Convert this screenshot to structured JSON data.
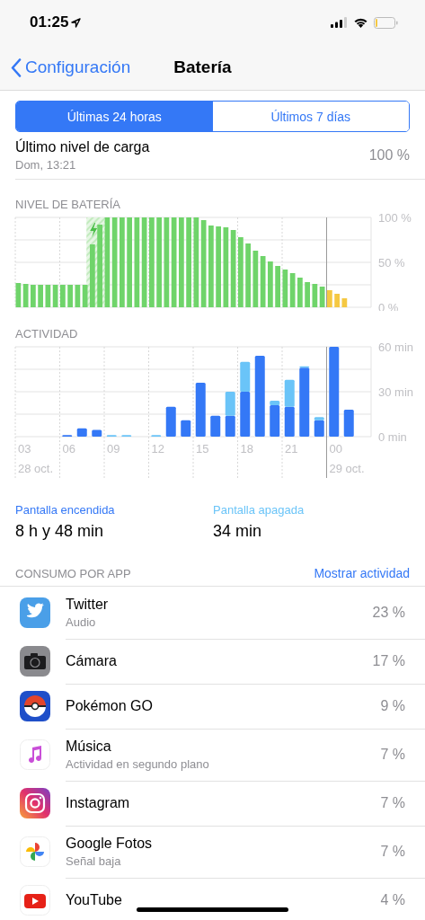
{
  "status_bar": {
    "time": "01:25"
  },
  "nav": {
    "back": "Configuración",
    "title": "Batería"
  },
  "segments": [
    {
      "label": "Últimas 24 horas",
      "selected": true
    },
    {
      "label": "Últimos 7 días",
      "selected": false
    }
  ],
  "last_charge": {
    "label": "Último nivel de carga",
    "date": "Dom, 13:21",
    "value": "100 %"
  },
  "battery_chart": {
    "title": "NIVEL DE BATERÍA",
    "chart_data": {
      "type": "bar",
      "ylim": [
        0,
        100
      ],
      "yticks": [
        {
          "value": 0,
          "label": "0 %"
        },
        {
          "value": 50,
          "label": "50 %"
        },
        {
          "value": 100,
          "label": "100 %"
        }
      ],
      "grid": true,
      "series": [
        {
          "color": "#6fd46a",
          "values": [
            27,
            26,
            25,
            25,
            25,
            25,
            25,
            25,
            25,
            25,
            70,
            92,
            100,
            100,
            100,
            100,
            100,
            100,
            100,
            100,
            100,
            100,
            100,
            100,
            100,
            97,
            91,
            90,
            89,
            86,
            78,
            71,
            63,
            57,
            51,
            46,
            42,
            38,
            33,
            28,
            26,
            23,
            null,
            null,
            null,
            null,
            null,
            null
          ]
        },
        {
          "color": "#f5c842",
          "values": [
            null,
            null,
            null,
            null,
            null,
            null,
            null,
            null,
            null,
            null,
            null,
            null,
            null,
            null,
            null,
            null,
            null,
            null,
            null,
            null,
            null,
            null,
            null,
            null,
            null,
            null,
            null,
            null,
            null,
            null,
            null,
            null,
            null,
            null,
            null,
            null,
            null,
            null,
            null,
            null,
            null,
            null,
            19,
            15,
            10,
            null,
            null,
            null
          ]
        }
      ]
    }
  },
  "activity_chart": {
    "title": "ACTIVIDAD",
    "chart_data": {
      "type": "bar",
      "stacked": true,
      "categories": [
        "03",
        null,
        null,
        "06",
        null,
        null,
        "09",
        null,
        null,
        "12",
        null,
        null,
        "15",
        null,
        null,
        "18",
        null,
        null,
        "21",
        null,
        null,
        "00",
        null,
        null
      ],
      "grid": true,
      "ylim": [
        0,
        60
      ],
      "yticks": [
        {
          "value": 0,
          "label": "0 min"
        },
        {
          "value": 30,
          "label": "30 min"
        },
        {
          "value": 60,
          "label": "60 min"
        }
      ],
      "series": [
        {
          "color": "#3478f6",
          "values": [
            0,
            0,
            0,
            1,
            5.5,
            4.5,
            0,
            0,
            0,
            0,
            20,
            11,
            36,
            14,
            14,
            30,
            54,
            21,
            20,
            46,
            11,
            60,
            18,
            0
          ]
        },
        {
          "color": "#6ac4f8",
          "values": [
            0,
            0,
            0,
            0,
            0,
            0,
            1,
            1,
            0,
            1,
            0,
            0,
            0,
            0,
            16,
            20,
            0,
            3,
            18,
            1,
            2,
            0,
            0,
            0
          ]
        }
      ]
    },
    "dates": [
      "28 oct.",
      "29 oct."
    ]
  },
  "screen_time": [
    {
      "label": "Pantalla encendida",
      "value": "8 h y 48 min",
      "color": "#3478f6"
    },
    {
      "label": "Pantalla apagada",
      "value": "34 min",
      "color": "#6ac4f8"
    }
  ],
  "usage": {
    "title": "CONSUMO POR APP",
    "action": "Mostrar actividad",
    "apps": [
      {
        "kind": "bird",
        "name": "Twitter",
        "detail": "Audio",
        "percent": "23 %"
      },
      {
        "kind": "camera",
        "name": "Cámara",
        "percent": "17 %"
      },
      {
        "kind": "ball",
        "name": "Pokémon GO",
        "percent": "9 %"
      },
      {
        "kind": "note",
        "name": "Música",
        "detail": "Actividad en segundo plano",
        "percent": "7 %"
      },
      {
        "kind": "lens",
        "name": "Instagram",
        "percent": "7 %"
      },
      {
        "kind": "pinwheel",
        "name": "Google Fotos",
        "detail": "Señal baja",
        "percent": "7 %"
      },
      {
        "kind": "play",
        "name": "YouTube",
        "percent": "4 %"
      }
    ]
  }
}
